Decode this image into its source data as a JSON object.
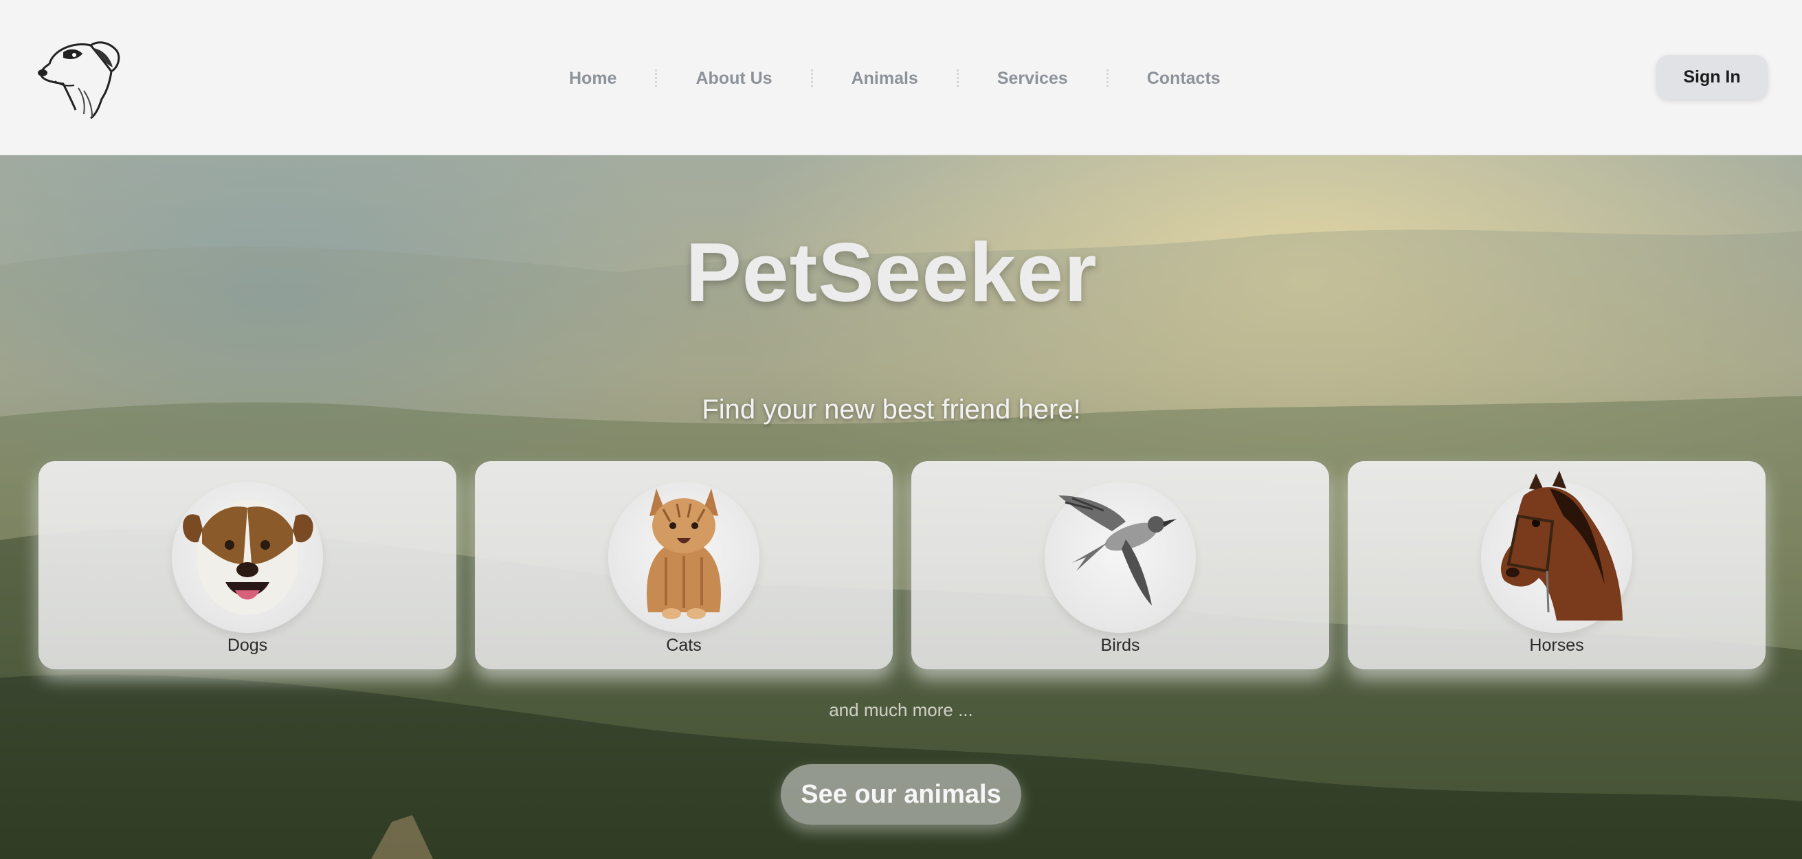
{
  "header": {
    "logo_icon": "dog-head-icon",
    "nav": [
      {
        "label": "Home"
      },
      {
        "label": "About Us"
      },
      {
        "label": "Animals"
      },
      {
        "label": "Services"
      },
      {
        "label": "Contacts"
      }
    ],
    "signin_label": "Sign In"
  },
  "hero": {
    "title": "PetSeeker",
    "subtitle": "Find your new best friend here!",
    "cards": [
      {
        "label": "Dogs",
        "icon": "dog-icon"
      },
      {
        "label": "Cats",
        "icon": "cat-icon"
      },
      {
        "label": "Birds",
        "icon": "bird-icon"
      },
      {
        "label": "Horses",
        "icon": "horse-icon"
      }
    ],
    "more_text": "and much more ...",
    "cta_label": "See our animals"
  },
  "colors": {
    "header_bg": "#f4f4f4",
    "nav_text": "#8d9299",
    "signin_bg": "#e1e2e6",
    "title_text": "#ececec"
  }
}
